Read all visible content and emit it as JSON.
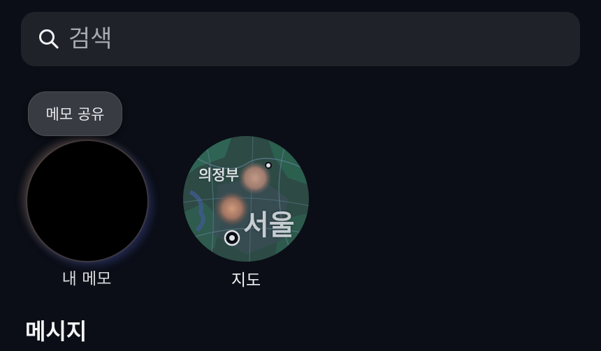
{
  "search": {
    "placeholder": "검색"
  },
  "notes": {
    "bubble_text": "메모 공유",
    "label": "내 메모"
  },
  "map": {
    "label": "지도",
    "city_small": "의정부",
    "city_large": "서울"
  },
  "messages": {
    "heading": "메시지"
  },
  "icons": {
    "search": "search-icon"
  },
  "colors": {
    "background": "#0b0e16",
    "search_bar": "#1f2229",
    "bubble": "#383b42",
    "map_land": "#2e4a44"
  }
}
